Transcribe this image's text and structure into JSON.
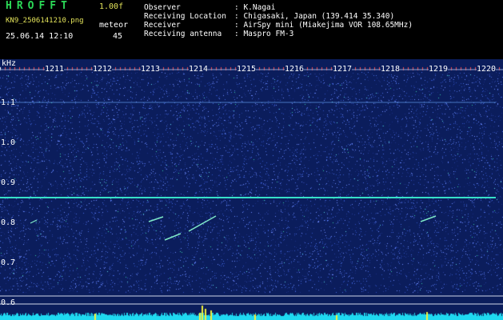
{
  "header": {
    "app_title": "HROFFT",
    "version": "1.00f",
    "file_name": "KN9_2506141210.png",
    "mode": "meteor",
    "date_time": "25.06.14 12:10",
    "count": "45"
  },
  "station_info": [
    {
      "label": "Observer",
      "value": ": K.Nagai"
    },
    {
      "label": "Receiving Location",
      "value": ": Chigasaki, Japan (139.414 35.340)"
    },
    {
      "label": "Receiver",
      "value": ": AirSpy mini (Miakejima VOR 108.65MHz)"
    },
    {
      "label": "Receiving antenna",
      "value": ": Maspro FM-3"
    }
  ],
  "spectrogram": {
    "y_unit": "kHz",
    "y_ticks": [
      "1.1",
      "1.0",
      "0.9",
      "0.8",
      "0.7",
      "0.6"
    ],
    "time_labels": [
      "1211",
      "1212",
      "1213",
      "1214",
      "1215",
      "1216",
      "1217",
      "1218",
      "1219",
      "1220"
    ],
    "background_color": "#0b1d5c",
    "carrier_color": "#37e0c8",
    "noise_floor_color": "#1fd8f0",
    "peak_color": "#f2f03a"
  }
}
